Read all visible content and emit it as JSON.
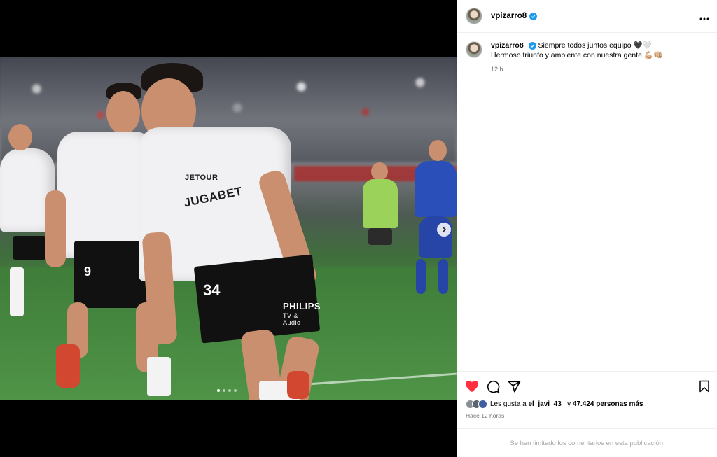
{
  "post": {
    "username": "vpizarro8",
    "more_icon": "more-horizontal-icon",
    "verified_icon": "verified-badge-icon",
    "caption_line1": "Siempre todos juntos equipo 🖤🤍",
    "caption_line2": "Hermoso triunfo y ambiente con nuestra gente 💪🏼👊🏼",
    "caption_age": "12 h"
  },
  "media": {
    "jersey_sponsor": "JUGABET",
    "jersey_brand": "JETOUR",
    "shorts_sponsor": "PHILIPS",
    "shorts_sub": "TV & Audio",
    "player_number": "34",
    "teammate_number": "9",
    "carousel_total": 4,
    "carousel_active": 1,
    "next_icon": "chevron-right-icon"
  },
  "actions": {
    "like_icon": "heart-filled-icon",
    "comment_icon": "comment-icon",
    "share_icon": "share-paper-plane-icon",
    "save_icon": "bookmark-icon",
    "like_color": "#ff3040"
  },
  "likes": {
    "prefix": "Les gusta a",
    "first_user": "el_javi_43_",
    "middle": "y",
    "others": "47.424 personas más"
  },
  "timestamp": "Hace 12 horas",
  "comments_notice": "Se han limitado los comentarios en esta publicación."
}
